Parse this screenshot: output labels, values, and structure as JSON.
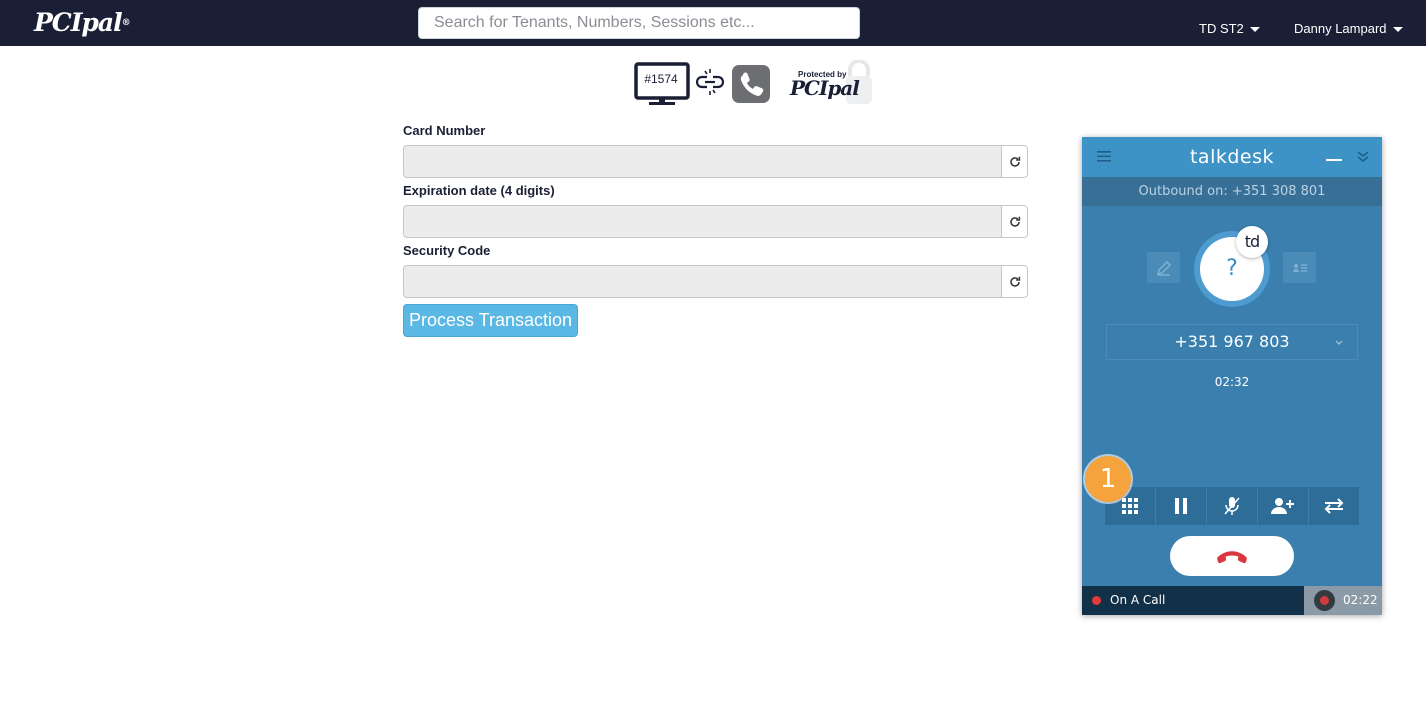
{
  "header": {
    "logo_text": "PCIpal",
    "logo_reg": "®",
    "search_placeholder": "Search for Tenants, Numbers, Sessions etc...",
    "tenant_dropdown": "TD ST2",
    "user_dropdown": "Danny Lampard"
  },
  "status": {
    "session_id": "#1574",
    "protected_label": "Protected by",
    "protected_logo": "PCIpal"
  },
  "form": {
    "fields": [
      {
        "label": "Card Number",
        "value": ""
      },
      {
        "label": "Expiration date (4 digits)",
        "value": ""
      },
      {
        "label": "Security Code",
        "value": ""
      }
    ],
    "submit_label": "Process Transaction"
  },
  "talkdesk": {
    "title": "talkdesk",
    "outbound": "Outbound on: +351 308 801",
    "avatar_placeholder": "?",
    "badge": "td",
    "phone_number": "+351 967 803",
    "call_timer": "02:32",
    "status_label": "On A Call",
    "recording_time": "02:22"
  },
  "annotation": {
    "step_number": "1"
  },
  "colors": {
    "nav_bg": "#1b1f36",
    "talkdesk_blue": "#3a7fae",
    "button_blue": "#5bb7e3",
    "step_orange": "#f5a33c",
    "hangup_red": "#d9363e"
  }
}
